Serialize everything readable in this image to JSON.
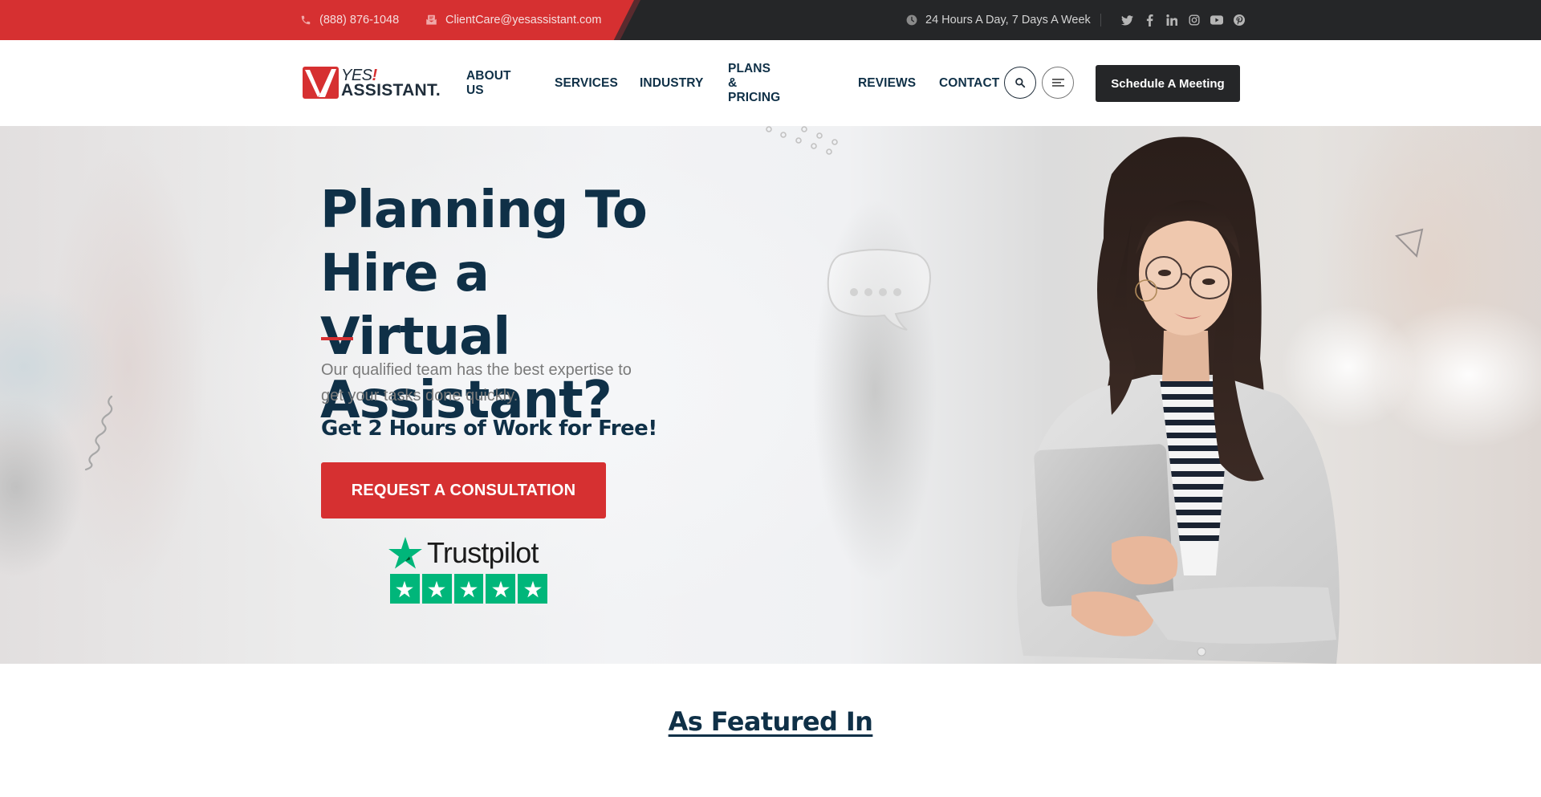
{
  "topbar": {
    "phone": "(888) 876-1048",
    "email": "ClientCare@yesassistant.com",
    "hours": "24 Hours A Day, 7 Days A Week",
    "socials": [
      "twitter-icon",
      "facebook-icon",
      "linkedin-icon",
      "instagram-icon",
      "youtube-icon",
      "pinterest-icon"
    ]
  },
  "brand": {
    "logo_top": "YES",
    "logo_exclaim": "!",
    "logo_bottom": "ASSISTANT.",
    "colors": {
      "primary_red": "#d63031",
      "navy": "#0f3047",
      "dark": "#252628",
      "trustpilot_green": "#00b67a"
    }
  },
  "nav": {
    "items": [
      {
        "label": "ABOUT US"
      },
      {
        "label": "SERVICES"
      },
      {
        "label": "INDUSTRY"
      },
      {
        "label": "PLANS & PRICING"
      },
      {
        "label": "REVIEWS"
      },
      {
        "label": "CONTACT"
      }
    ],
    "search_icon": "search-icon",
    "menu_icon": "menu-icon",
    "cta_label": "Schedule A Meeting"
  },
  "hero": {
    "title_line1": "Planning To Hire a",
    "title_line2": "Virtual Assistant?",
    "subtitle": "Our qualified team has the best expertise to get your tasks done quickly.",
    "offer": "Get 2 Hours of Work for Free!",
    "cta_label": "REQUEST A CONSULTATION",
    "trustpilot": {
      "name": "Trustpilot",
      "rating_stars": 5,
      "max_stars": 5
    }
  },
  "featured": {
    "heading": "As Featured In"
  }
}
